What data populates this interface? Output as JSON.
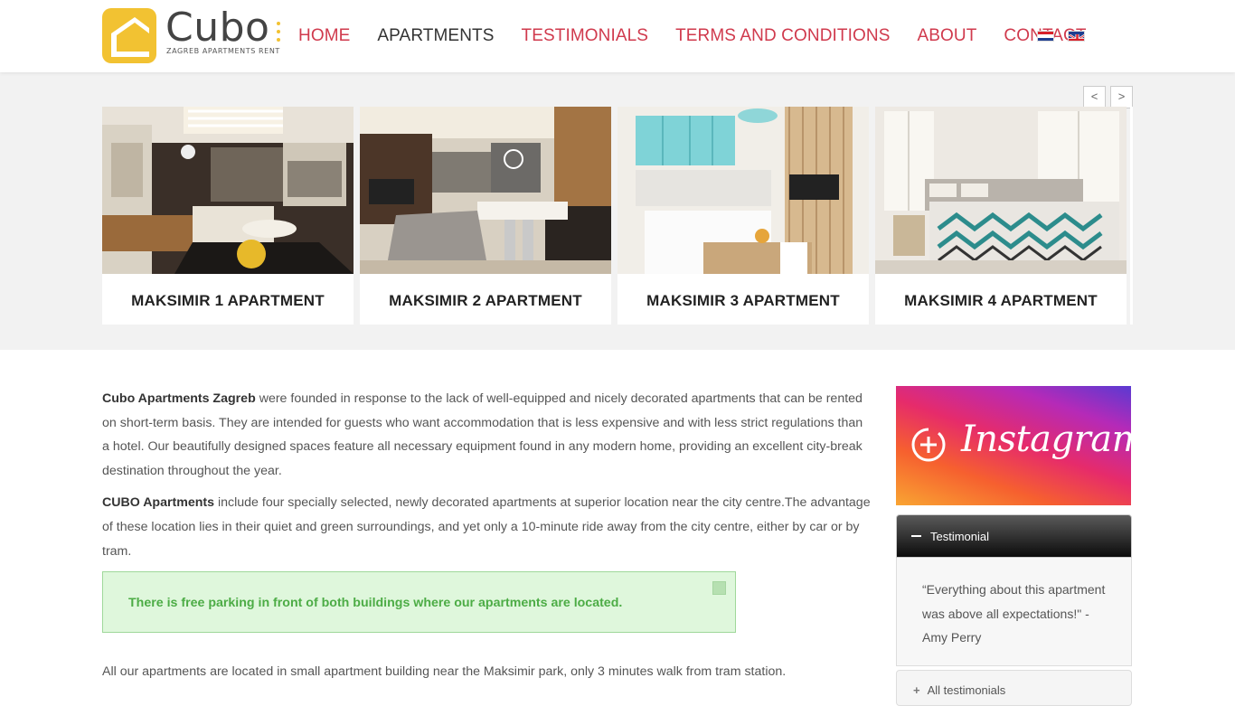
{
  "brand": {
    "name": "Cubo",
    "tagline": "ZAGREB APARTMENTS RENT",
    "color": "#f2c232"
  },
  "nav": {
    "items": [
      "HOME",
      "APARTMENTS",
      "TESTIMONIALS",
      "TERMS AND CONDITIONS",
      "ABOUT",
      "CONTACT"
    ],
    "active_index": 1,
    "color": "#d03a4d",
    "languages": [
      "croatian-flag-icon",
      "uk-flag-icon"
    ]
  },
  "slider": {
    "prev_label": "<",
    "next_label": ">",
    "cards": [
      {
        "title": "MAKSIMIR 1 APARTMENT"
      },
      {
        "title": "MAKSIMIR 2 APARTMENT"
      },
      {
        "title": "MAKSIMIR 3 APARTMENT"
      },
      {
        "title": "MAKSIMIR 4 APARTMENT"
      }
    ]
  },
  "content": {
    "p1_bold": "Cubo Apartments Zagreb",
    "p1_rest": " were founded in response to the lack of well-equipped and nicely decorated apartments that can be rented on short-term basis. They are intended for guests who want accommodation that is less expensive and with less strict regulations than a hotel. Our beautifully designed spaces feature all necessary equipment found in any modern home, providing an excellent city-break destination throughout the year.",
    "p2_bold": "CUBO Apartments",
    "p2_rest": " include four specially selected, newly decorated  apartments at superior location near the city centre.The advantage of these location lies in their quiet and green surroundings, and yet only a 10-minute ride away from the city centre, either by car or by tram.",
    "notice": "There is free parking in front of both buildings where our apartments are located.",
    "p3": "All our apartments are located in small apartment building near the Maksimir park, only 3 minutes walk from tram station."
  },
  "sidebar": {
    "instagram_label": "Instagram",
    "testimonial_header": "Testimonial",
    "testimonial_text": "“Everything about this apartment was above all expectations!\" - Amy Perry",
    "all_testimonials": "All testimonials"
  }
}
